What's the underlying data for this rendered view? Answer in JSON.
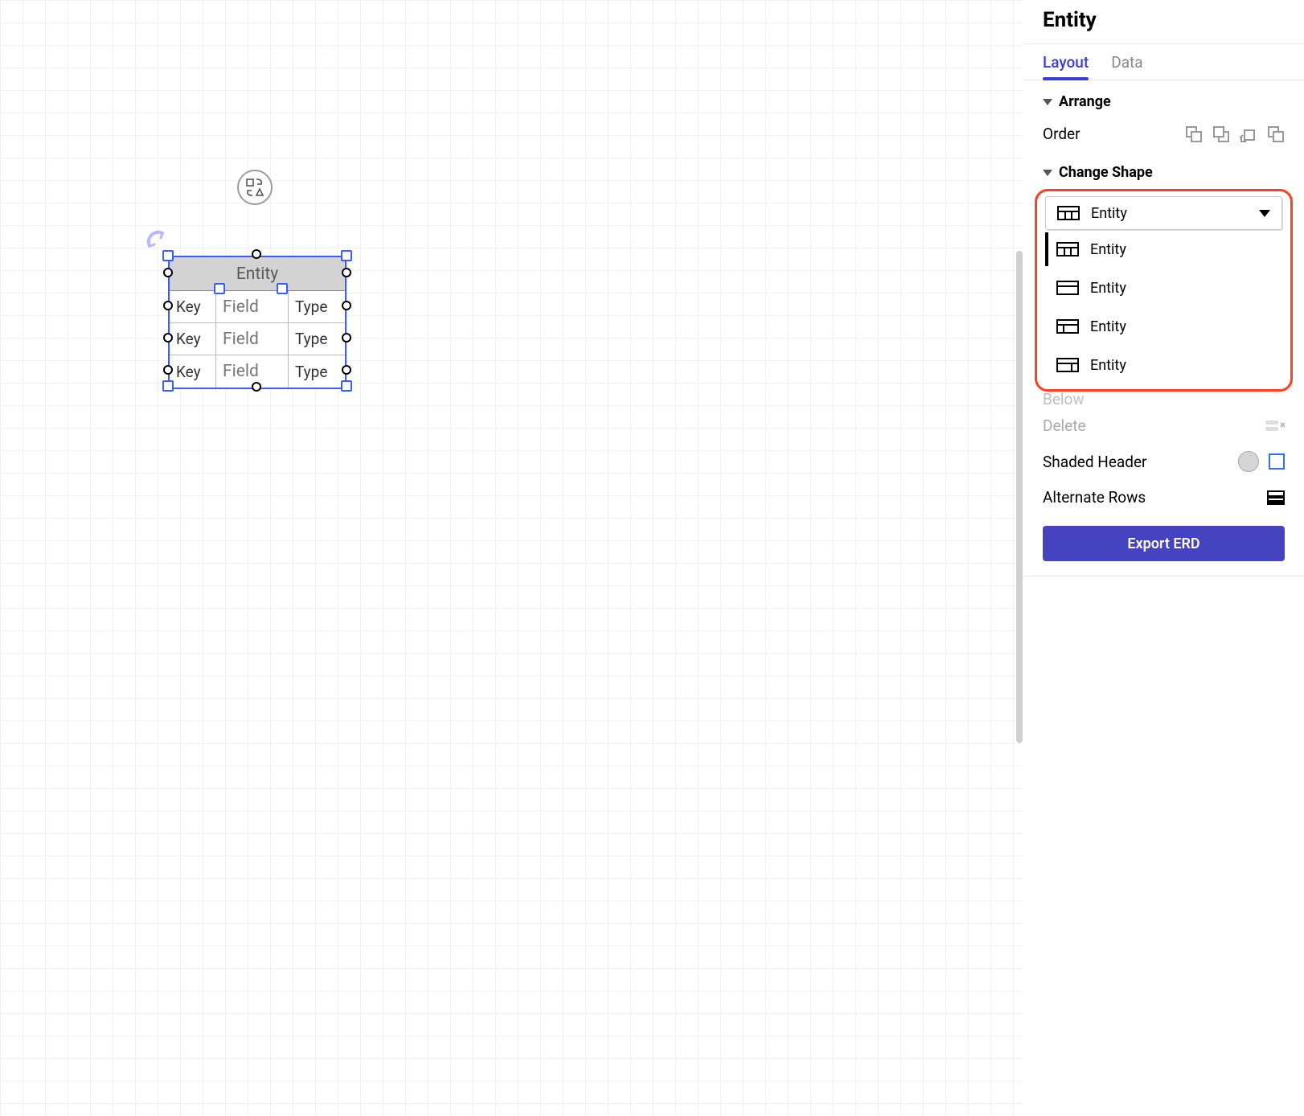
{
  "sidebar": {
    "title": "Entity",
    "tabs": {
      "layout": "Layout",
      "data": "Data"
    },
    "arrange": {
      "header": "Arrange",
      "order_label": "Order"
    },
    "change_shape": {
      "header": "Change Shape",
      "selected": "Entity",
      "options": [
        "Entity",
        "Entity",
        "Entity",
        "Entity"
      ]
    },
    "below_label": "Below",
    "delete_label": "Delete",
    "shaded_header_label": "Shaded Header",
    "alternate_rows_label": "Alternate Rows",
    "export_label": "Export ERD"
  },
  "entity": {
    "title": "Entity",
    "rows": [
      {
        "key": "Key",
        "field": "Field",
        "type": "Type"
      },
      {
        "key": "Key",
        "field": "Field",
        "type": "Type"
      },
      {
        "key": "Key",
        "field": "Field",
        "type": "Type"
      }
    ]
  }
}
